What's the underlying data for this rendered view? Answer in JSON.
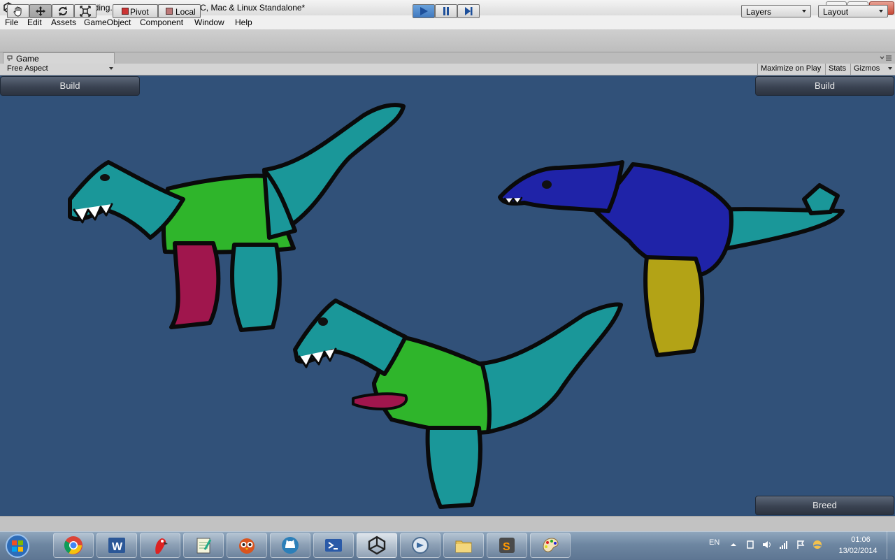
{
  "window": {
    "title": "Unity - RandomBreeding.unity - eap_frontend - PC, Mac & Linux Standalone*"
  },
  "menu": [
    "File",
    "Edit",
    "Assets",
    "GameObject",
    "Component",
    "Window",
    "Help"
  ],
  "toolbar": {
    "tools": [
      {
        "icon": "hand-tool-icon",
        "active": false
      },
      {
        "icon": "move-tool-icon",
        "active": true
      },
      {
        "icon": "rotate-tool-icon",
        "active": false
      },
      {
        "icon": "scale-tool-icon",
        "active": false
      }
    ],
    "pivot_label": "Pivot",
    "local_label": "Local",
    "playback": [
      {
        "icon": "play-icon",
        "active": true
      },
      {
        "icon": "pause-icon",
        "active": false
      },
      {
        "icon": "step-icon",
        "active": false
      }
    ],
    "layers_label": "Layers",
    "layout_label": "Layout"
  },
  "game_panel": {
    "tab_label": "Game",
    "aspect": "Free Aspect",
    "maximize_label": "Maximize on Play",
    "stats_label": "Stats",
    "gizmos_label": "Gizmos",
    "background": "#315179"
  },
  "game": {
    "build_left_label": "Build",
    "build_right_label": "Build",
    "breed_label": "Breed",
    "creatures": [
      {
        "name": "creature-top-left",
        "body": "#2fb52b",
        "head": "#1a9799",
        "neck": "#1a9799",
        "tail": "#1a9799",
        "leg1": "#a0164d",
        "leg2": "#1a9799"
      },
      {
        "name": "creature-right",
        "body": "#1f23a8",
        "head": "#1f23a8",
        "tail": "#1a9799",
        "leg": "#b3a316"
      },
      {
        "name": "creature-bottom",
        "body": "#2fb52b",
        "head": "#1a9799",
        "tail": "#1a9799",
        "leg": "#1a9799",
        "arm": "#a0164d"
      }
    ]
  },
  "taskbar": {
    "apps": [
      "chrome-icon",
      "word-icon",
      "parrot-icon",
      "notepad-icon",
      "owl-icon",
      "cat-icon",
      "powershell-icon",
      "unity-icon",
      "remote-desktop-icon",
      "explorer-icon",
      "sublime-icon",
      "paint-icon"
    ],
    "active_app": "unity-icon",
    "language": "EN",
    "time": "01:06",
    "date": "13/02/2014"
  }
}
